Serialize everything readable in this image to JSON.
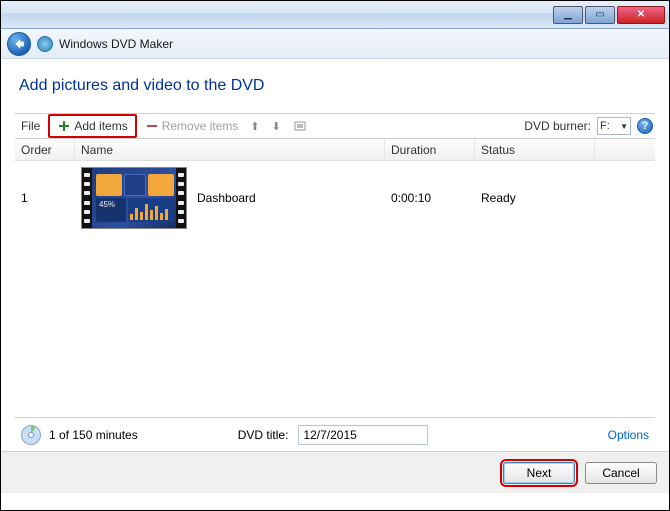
{
  "window": {
    "title": "Windows DVD Maker"
  },
  "page": {
    "heading": "Add pictures and video to the DVD"
  },
  "toolbar": {
    "file_label": "File",
    "add_items_label": "Add items",
    "remove_items_label": "Remove items",
    "burner_label": "DVD burner:",
    "burner_value": "F:"
  },
  "columns": {
    "order": "Order",
    "name": "Name",
    "duration": "Duration",
    "status": "Status"
  },
  "items": [
    {
      "order": "1",
      "name": "Dashboard",
      "duration": "0:00:10",
      "status": "Ready"
    }
  ],
  "status": {
    "minutes_text": "1 of 150 minutes",
    "title_label": "DVD title:",
    "title_value": "12/7/2015",
    "options_label": "Options"
  },
  "footer": {
    "next_label": "Next",
    "cancel_label": "Cancel"
  }
}
